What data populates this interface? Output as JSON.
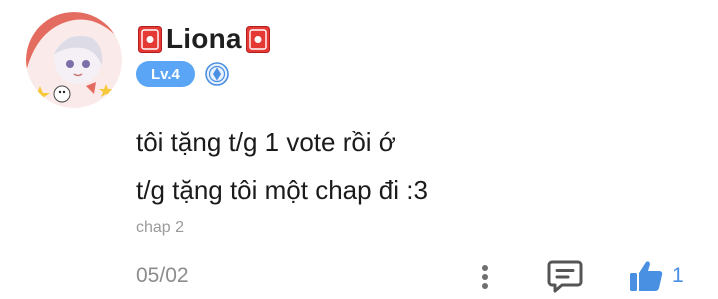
{
  "comment": {
    "user": {
      "name": "Liona",
      "level": "Lv.4"
    },
    "text_lines": [
      "tôi tặng t/g 1 vote rồi ớ",
      "t/g tặng tôi một chap đi :3"
    ],
    "chapter": "chap 2",
    "date": "05/02",
    "likes": "1"
  },
  "colors": {
    "accent_blue": "#4a90e2",
    "badge_blue": "#5aa5f5",
    "card_red": "#e53935"
  },
  "icons": {
    "name_decoration": "red-card-icon",
    "verified": "blue-emblem-icon",
    "more": "more-vertical-icon",
    "reply": "speech-bubble-icon",
    "like": "thumbs-up-icon"
  }
}
